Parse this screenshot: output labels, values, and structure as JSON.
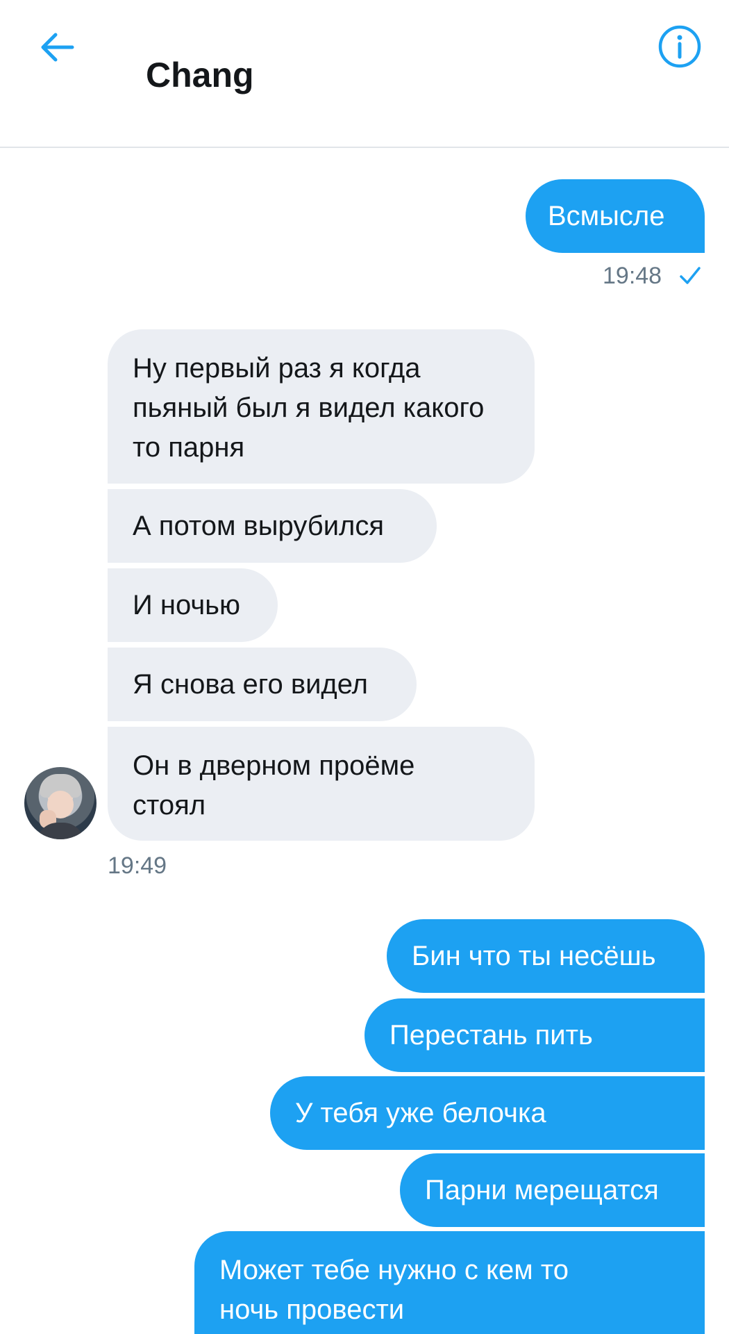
{
  "header": {
    "title": "Chang"
  },
  "colors": {
    "accent": "#1da1f2",
    "incoming_bubble": "#ebeef3",
    "text_dark": "#14171a",
    "meta_gray": "#657786"
  },
  "icons": {
    "back": "arrow-left-icon",
    "info": "info-circle-icon",
    "read": "checkmark-icon"
  },
  "messages": {
    "out_1": "Всмысле",
    "time_1": "19:48",
    "in_1": "Ну первый раз я когда пьяный был я видел какого то парня",
    "in_2": "А потом вырубился",
    "in_3": "И ночью",
    "in_4": "Я снова его видел",
    "in_5": "Он в дверном проёме стоял",
    "time_2": "19:49",
    "out_2": "Бин что ты несёшь",
    "out_3": "Перестань пить",
    "out_4": "У тебя уже белочка",
    "out_5": "Парни мерещатся",
    "out_6": "Может тебе нужно с кем то ночь провести"
  }
}
